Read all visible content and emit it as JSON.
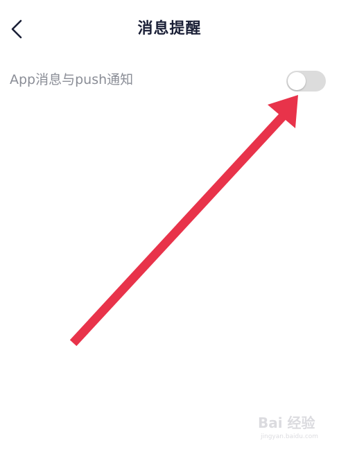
{
  "header": {
    "title": "消息提醒",
    "back_icon": "chevron-left-icon"
  },
  "settings": {
    "push_notifications": {
      "label": "App消息与push通知",
      "enabled": false
    }
  },
  "annotation": {
    "arrow_color": "#e8334a"
  },
  "watermark": {
    "brand": "Bai 经验",
    "url": "jingyan.baidu.com"
  },
  "colors": {
    "title": "#1a1f36",
    "label": "#8a8d96",
    "toggle_off": "#dcdcdc"
  }
}
